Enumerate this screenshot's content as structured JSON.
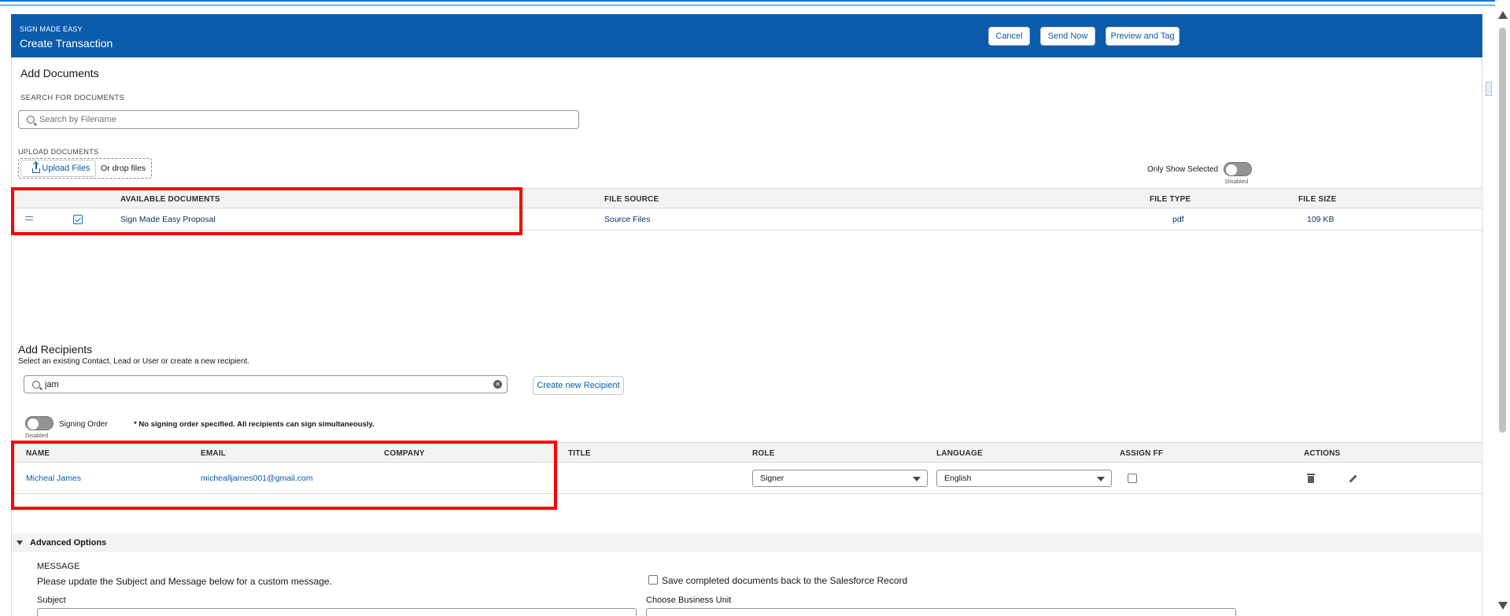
{
  "header": {
    "app_name": "SIGN MADE EASY",
    "title": "Create Transaction",
    "cancel_label": "Cancel",
    "send_now_label": "Send Now",
    "preview_label": "Preview and Tag"
  },
  "documents": {
    "heading": "Add Documents",
    "search_label": "SEARCH FOR DOCUMENTS",
    "search_placeholder": "Search by Filename",
    "upload_label": "UPLOAD DOCUMENTS",
    "upload_button": "Upload Files",
    "drop_text": "Or drop files",
    "only_selected_label": "Only Show Selected",
    "only_selected_state": "Disabled",
    "columns": [
      "AVAILABLE DOCUMENTS",
      "FILE SOURCE",
      "FILE TYPE",
      "FILE SIZE"
    ],
    "rows": [
      {
        "name": "Sign Made Easy Proposal",
        "source": "Source Files",
        "type": "pdf",
        "size": "109 KB",
        "checked": true
      }
    ]
  },
  "recipients": {
    "heading": "Add Recipients",
    "subtitle": "Select an existing Contact, Lead or User or create a new recipient.",
    "search_value": "jam",
    "create_button": "Create new Recipient",
    "signing_order_label": "Signing Order",
    "signing_order_state": "Disabled",
    "signing_order_note": "* No signing order specified. All recipients can sign simultaneously.",
    "columns": [
      "NAME",
      "EMAIL",
      "COMPANY",
      "TITLE",
      "ROLE",
      "LANGUAGE",
      "ASSIGN FF",
      "ACTIONS"
    ],
    "rows": [
      {
        "name": "Micheal James",
        "email": "michealljames001@gmail.com",
        "company": "",
        "title": "",
        "role": "Signer",
        "language": "English",
        "assign_ff": false
      }
    ]
  },
  "advanced": {
    "heading": "Advanced Options",
    "message_label": "MESSAGE",
    "message_hint": "Please update the Subject and Message below for a custom message.",
    "save_back_label": "Save completed documents back to the Salesforce Record",
    "subject_label": "Subject",
    "business_unit_label": "Choose Business Unit"
  },
  "colors": {
    "header_bg": "#0b5cab",
    "accent": "#0176d3",
    "highlight": "#ff0000"
  }
}
